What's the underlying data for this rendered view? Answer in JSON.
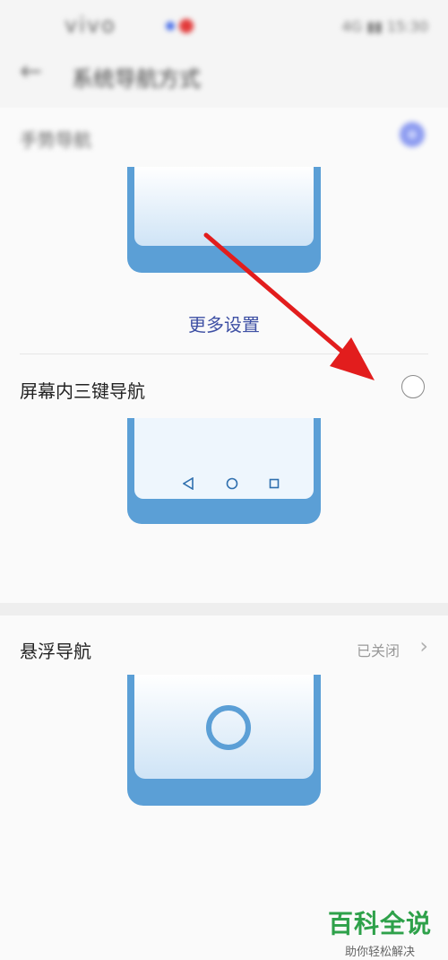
{
  "status_bar": {
    "carrier": "vivo",
    "right_text": "4G ▮▮ 15:30"
  },
  "header": {
    "title": "系统导航方式"
  },
  "options": {
    "gesture": {
      "label": "手势导航",
      "selected": true,
      "more_settings": "更多设置"
    },
    "three_key": {
      "label": "屏幕内三键导航",
      "selected": false
    },
    "floating": {
      "label": "悬浮导航",
      "status": "已关闭"
    }
  },
  "watermark": {
    "title": "百科全说",
    "subtitle": "助你轻松解决"
  },
  "colors": {
    "accent": "#3e50a4",
    "phone_frame": "#5b9fd6",
    "arrow": "#e21d1d",
    "watermark": "#2ea14a"
  },
  "icons": [
    "back-arrow-icon",
    "radio-selected-icon",
    "radio-empty-icon",
    "triangle-back-icon",
    "circle-home-icon",
    "square-recents-icon",
    "chevron-right-icon",
    "float-ball-icon"
  ]
}
